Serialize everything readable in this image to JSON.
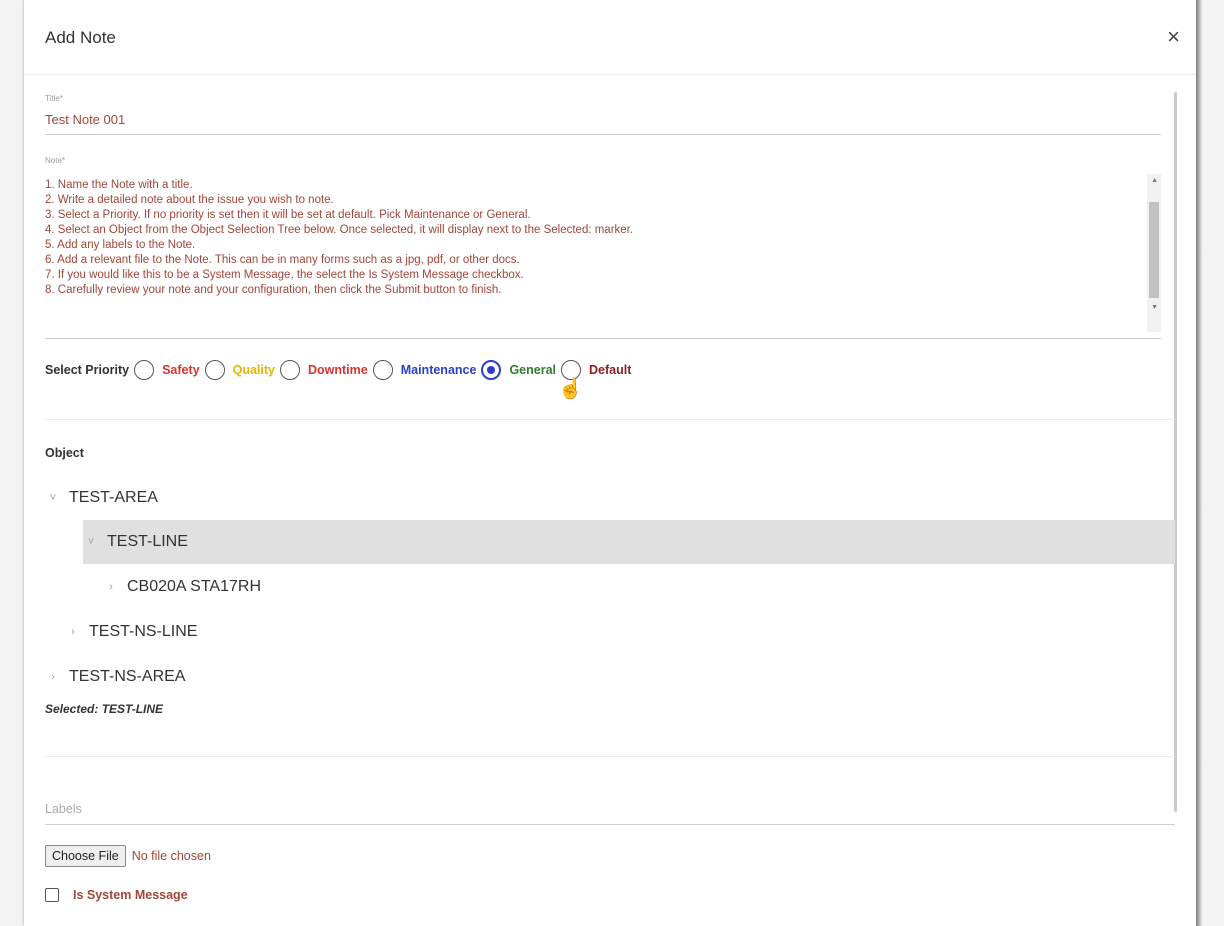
{
  "dialog": {
    "title": "Add Note",
    "close_glyph": "×"
  },
  "title_field": {
    "label": "Title*",
    "value": "Test Note 001"
  },
  "note_field": {
    "label": "Note*",
    "lines": [
      "1. Name the Note with a title.",
      "2. Write a detailed note about the issue you wish to note.",
      "3. Select a Priority. If no priority is set then it will be set at default. Pick Maintenance or General.",
      "4. Select an Object from the Object Selection Tree below. Once selected, it will display next to the Selected: marker.",
      "5. Add any labels to the Note.",
      "6. Add a relevant file to the Note. This can be in many forms such as a jpg, pdf, or other docs.",
      "7. If you would like this to be a System Message, the select the Is System Message checkbox.",
      "8. Carefully review your note and your configuration, then click the Submit button to finish."
    ]
  },
  "priority": {
    "label": "Select Priority",
    "selected": "General",
    "options": [
      {
        "label": "Safety",
        "color": "#d9342b"
      },
      {
        "label": "Quality",
        "color": "#e8b400"
      },
      {
        "label": "Downtime",
        "color": "#d9342b"
      },
      {
        "label": "Maintenance",
        "color": "#2b3fc7"
      },
      {
        "label": "General",
        "color": "#2e7d32"
      },
      {
        "label": "Default",
        "color": "#8b1f1f"
      }
    ]
  },
  "object": {
    "label": "Object",
    "tree": [
      {
        "label": "TEST-AREA",
        "toggle": "˅",
        "selected": false
      },
      {
        "label": "TEST-LINE",
        "toggle": "˅",
        "selected": true
      },
      {
        "label": "CB020A STA17RH",
        "toggle": "›",
        "selected": false
      },
      {
        "label": "TEST-NS-LINE",
        "toggle": "›",
        "selected": false
      },
      {
        "label": "TEST-NS-AREA",
        "toggle": "›",
        "selected": false
      }
    ],
    "selected_text": "Selected: TEST-LINE"
  },
  "labels_field": {
    "placeholder": "Labels"
  },
  "file": {
    "button_label": "Choose File",
    "status": "No file chosen"
  },
  "system_message": {
    "label": "Is System Message",
    "checked": false
  }
}
